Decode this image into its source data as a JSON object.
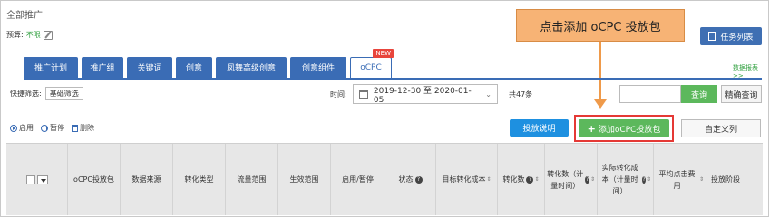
{
  "page": {
    "title": "全部推广"
  },
  "budget": {
    "label": "预算:",
    "value": "不限"
  },
  "callout": {
    "text": "点击添加 oCPC 投放包"
  },
  "header": {
    "task_list": "任务列表"
  },
  "tabs": [
    {
      "label": "推广计划"
    },
    {
      "label": "推广组"
    },
    {
      "label": "关键词"
    },
    {
      "label": "创意"
    },
    {
      "label": "凤舞高级创意"
    },
    {
      "label": "创意组件"
    },
    {
      "label": "oCPC",
      "badge": "NEW",
      "active": true
    }
  ],
  "data_report": "数据报表>>",
  "filters": {
    "quick_label": "快捷筛选:",
    "basic_filter": "基础筛选",
    "time_label": "时间:",
    "date_range": "2019-12-30 至 2020-01-05",
    "total": "共47条",
    "search_placeholder": "",
    "query": "查询",
    "precise_query": "精确查询"
  },
  "actions": {
    "enable": "启用",
    "pause": "暂停",
    "delete": "删除"
  },
  "buttons": {
    "explain": "投放说明",
    "add_package": "添加oCPC投放包",
    "custom_columns": "自定义列"
  },
  "table": {
    "columns": [
      "oCPC投放包",
      "数据来源",
      "转化类型",
      "流量范围",
      "生效范围",
      "启用/暂停",
      "状态",
      "目标转化成本",
      "转化数",
      "转化数（计量时间）",
      "实际转化成本（计量时间）",
      "平均点击费用",
      "投放阶段"
    ]
  },
  "colors": {
    "tab_blue": "#3a6cb5",
    "green": "#5cb85c",
    "callout": "#f7b375",
    "highlight": "#e53935"
  }
}
